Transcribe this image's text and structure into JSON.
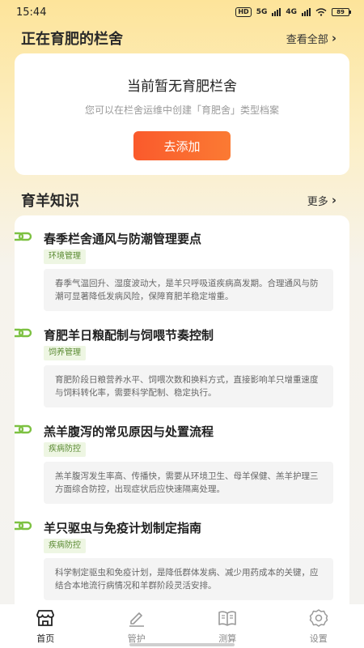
{
  "status_bar": {
    "time": "15:44",
    "net1": "HD",
    "net2": "5G",
    "net3": "4G",
    "battery": "89"
  },
  "fattening": {
    "title": "正在育肥的栏舍",
    "view_all": "查看全部",
    "empty_title": "当前暂无育肥栏舍",
    "empty_desc": "您可以在栏舍运维中创建「育肥舍」类型档案",
    "add_button": "去添加"
  },
  "knowledge": {
    "title": "育羊知识",
    "more": "更多",
    "articles": [
      {
        "title": "春季栏舍通风与防潮管理要点",
        "tag": "环境管理",
        "summary": "春季气温回升、湿度波动大，是羊只呼吸道疾病高发期。合理通风与防潮可显著降低发病风险，保障育肥羊稳定增重。"
      },
      {
        "title": "育肥羊日粮配制与饲喂节奏控制",
        "tag": "饲养管理",
        "summary": "育肥阶段日粮营养水平、饲喂次数和换料方式，直接影响羊只增重速度与饲料转化率，需要科学配制、稳定执行。"
      },
      {
        "title": "羔羊腹泻的常见原因与处置流程",
        "tag": "疾病防控",
        "summary": "羔羊腹泻发生率高、传播快，需要从环境卫生、母羊保健、羔羊护理三方面综合防控，出现症状后应快速隔离处理。"
      },
      {
        "title": "羊只驱虫与免疫计划制定指南",
        "tag": "疾病防控",
        "summary": "科学制定驱虫和免疫计划，是降低群体发病、减少用药成本的关键，应结合本地流行病情况和羊群阶段灵活安排。"
      }
    ]
  },
  "tabs": [
    {
      "label": "首页",
      "icon": "store-icon",
      "active": true
    },
    {
      "label": "管护",
      "icon": "edit-icon",
      "active": false
    },
    {
      "label": "测算",
      "icon": "book-icon",
      "active": false
    },
    {
      "label": "设置",
      "icon": "gear-icon",
      "active": false
    }
  ],
  "colors": {
    "accent": "#FA5A2C",
    "tag_bg": "#EEF6E3",
    "tag_text": "#5A8A32",
    "link_icon": "#7DC142"
  }
}
